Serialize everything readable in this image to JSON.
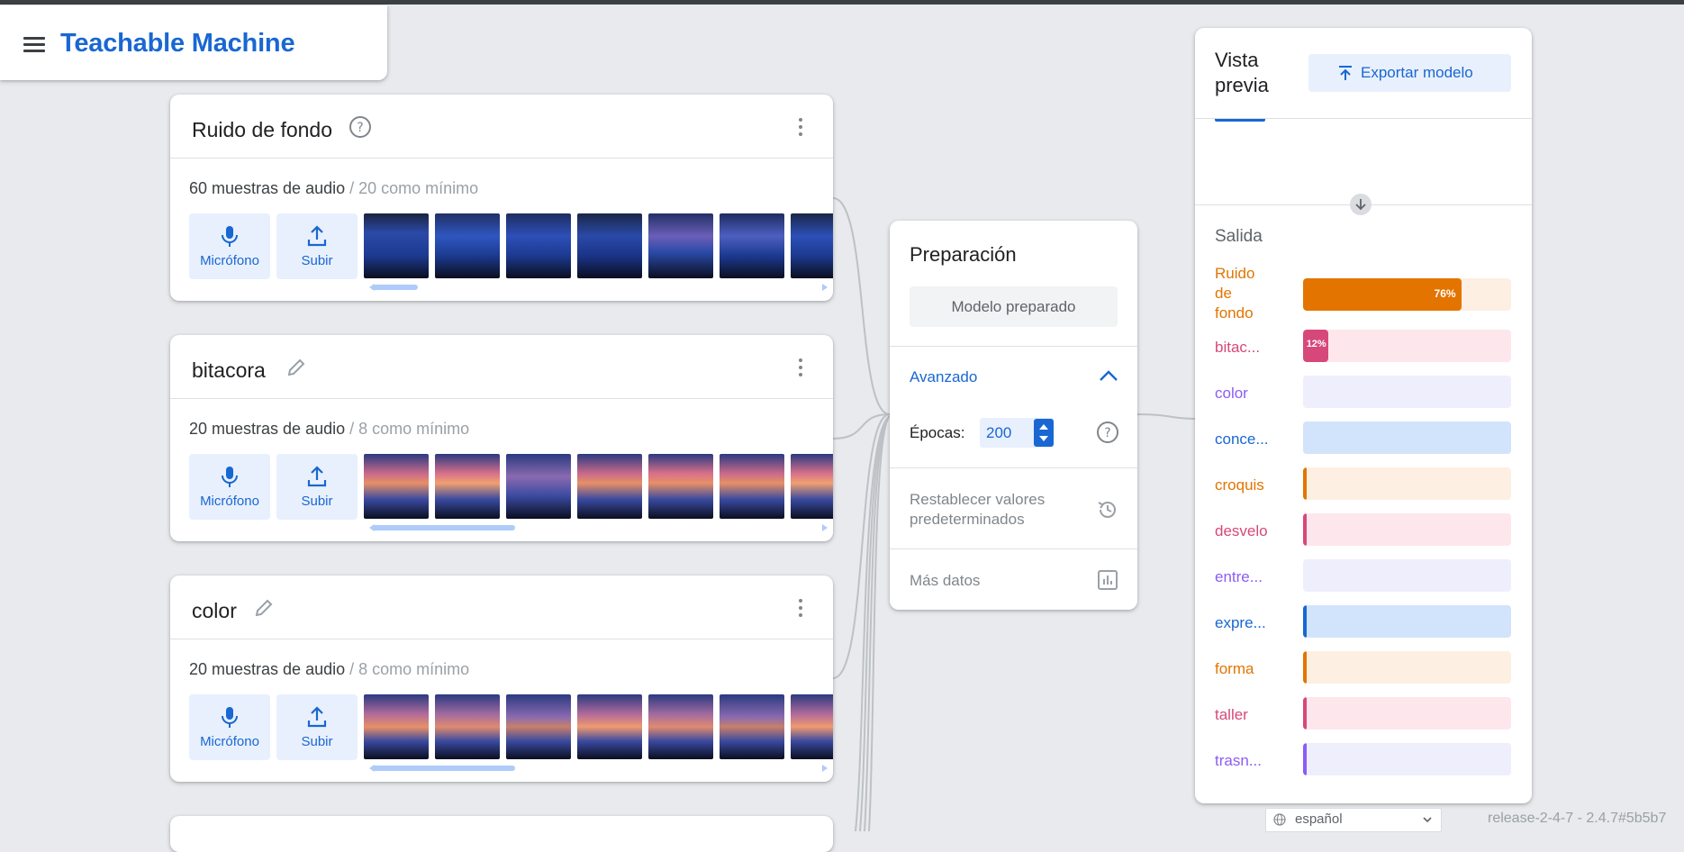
{
  "app": {
    "title": "Teachable Machine"
  },
  "classes": [
    {
      "name": "Ruido de fondo",
      "title_icon": "help-circle-icon",
      "sample_count": "60 muestras de audio",
      "minimum": "/ 20 como mínimo",
      "mic_label": "Micrófono",
      "upload_label": "Subir"
    },
    {
      "name": "bitacora",
      "title_icon": "pencil-icon",
      "sample_count": "20 muestras de audio",
      "minimum": "/ 8 como mínimo",
      "mic_label": "Micrófono",
      "upload_label": "Subir"
    },
    {
      "name": "color",
      "title_icon": "pencil-icon",
      "sample_count": "20 muestras de audio",
      "minimum": "/ 8 como mínimo",
      "mic_label": "Micrófono",
      "upload_label": "Subir"
    }
  ],
  "training": {
    "title": "Preparación",
    "train_button": "Modelo preparado",
    "advanced_label": "Avanzado",
    "epochs_label": "Épocas:",
    "epochs_value": "200",
    "reset_label": "Restablecer valores predeterminados",
    "more_data_label": "Más datos"
  },
  "preview": {
    "title": "Vista previa",
    "export_button": "Exportar modelo",
    "output_label": "Salida",
    "outputs": [
      {
        "label": "Ruido de fondo",
        "percent": 76,
        "pct_label": "76%",
        "color": "#e37400",
        "bg": "#feefe3"
      },
      {
        "label": "bitac...",
        "percent": 12,
        "pct_label": "12%",
        "color": "#d7487a",
        "bg": "#fde7ec"
      },
      {
        "label": "color",
        "percent": 0,
        "pct_label": "",
        "color": "#8b5cf6",
        "bg": "#efeefc"
      },
      {
        "label": "conce...",
        "percent": 0,
        "pct_label": "",
        "color": "#1967d2",
        "bg": "#d2e3fc"
      },
      {
        "label": "croquis",
        "percent": 1,
        "pct_label": "",
        "color": "#e37400",
        "bg": "#feefe3"
      },
      {
        "label": "desvelo",
        "percent": 0.4,
        "pct_label": "",
        "color": "#d7487a",
        "bg": "#fde7ec"
      },
      {
        "label": "entre...",
        "percent": 0,
        "pct_label": "",
        "color": "#8b5cf6",
        "bg": "#efeefc"
      },
      {
        "label": "expre...",
        "percent": 1.2,
        "pct_label": "",
        "color": "#1967d2",
        "bg": "#d2e3fc"
      },
      {
        "label": "forma",
        "percent": 1,
        "pct_label": "",
        "color": "#e37400",
        "bg": "#feefe3"
      },
      {
        "label": "taller",
        "percent": 0.4,
        "pct_label": "",
        "color": "#d7487a",
        "bg": "#fde7ec"
      },
      {
        "label": "trasn...",
        "percent": 1,
        "pct_label": "",
        "color": "#8b5cf6",
        "bg": "#efeefc"
      }
    ]
  },
  "footer": {
    "language": "español",
    "release": "release-2-4-7 - 2.4.7#5b5b7"
  }
}
